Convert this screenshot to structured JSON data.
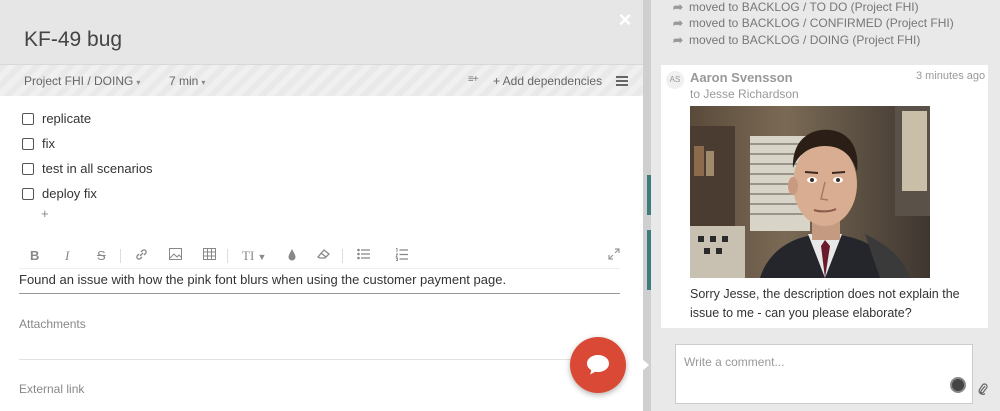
{
  "task": {
    "close_icon": "×",
    "title": "KF-49 bug",
    "project_status": "Project FHI / DOING",
    "time_estimate": "7 min",
    "add_dependencies": "+ Add dependencies",
    "checklist": [
      {
        "label": "replicate",
        "checked": false
      },
      {
        "label": "fix",
        "checked": false
      },
      {
        "label": "test in all scenarios",
        "checked": false
      },
      {
        "label": "deploy fix",
        "checked": false
      }
    ],
    "add_item": "+",
    "toolbar": {
      "bold": "B",
      "italic": "I",
      "strike": "S",
      "link_icon": "link-icon",
      "image_icon": "image-icon",
      "table_icon": "table-icon",
      "heading": "TI",
      "color_icon": "drop-icon",
      "eraser_icon": "eraser-icon",
      "bullets_icon": "bullet-list-icon",
      "numbers_icon": "numbered-list-icon",
      "expand_icon": "expand-icon"
    },
    "description": "Found an issue with how the pink font blurs when using the customer payment page.",
    "attachments_label": "Attachments",
    "external_link_label": "External link"
  },
  "activity": {
    "history": [
      "moved to BACKLOG / TO DO (Project FHI)",
      "moved to BACKLOG / CONFIRMED (Project FHI)",
      "moved to BACKLOG / DOING (Project FHI)"
    ],
    "comment": {
      "avatar_initials": "AS",
      "author": "Aaron Svensson",
      "time": "3 minutes ago",
      "recipient": "to Jesse Richardson",
      "text": "Sorry Jesse, the description does not explain the issue to me - can you please elaborate?"
    },
    "comment_placeholder": "Write a comment..."
  },
  "colors": {
    "fab": "#d94935",
    "header_bg": "#e6e6e6",
    "activity_bg": "#e9e9e9"
  }
}
